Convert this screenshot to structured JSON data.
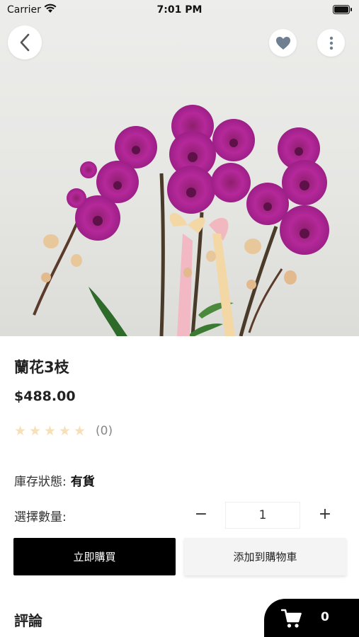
{
  "status_bar": {
    "carrier": "Carrier",
    "time": "7:01 PM"
  },
  "product": {
    "name": "蘭花3枝",
    "price": "$488.00",
    "rating_stars": 0,
    "rating_max": 5,
    "review_count": "(0)",
    "stock_label": "庫存狀態:",
    "stock_value": "有貨"
  },
  "quantity": {
    "label": "選擇數量:",
    "value": "1",
    "minus": "−",
    "plus": "+"
  },
  "actions": {
    "buy_now": "立即購買",
    "add_to_cart": "添加到購物車"
  },
  "reviews": {
    "heading": "評論"
  },
  "cart": {
    "count": "0"
  },
  "colors": {
    "star_empty": "#f7e0b8",
    "primary_button": "#000000",
    "secondary_button": "#f4f4f4"
  }
}
